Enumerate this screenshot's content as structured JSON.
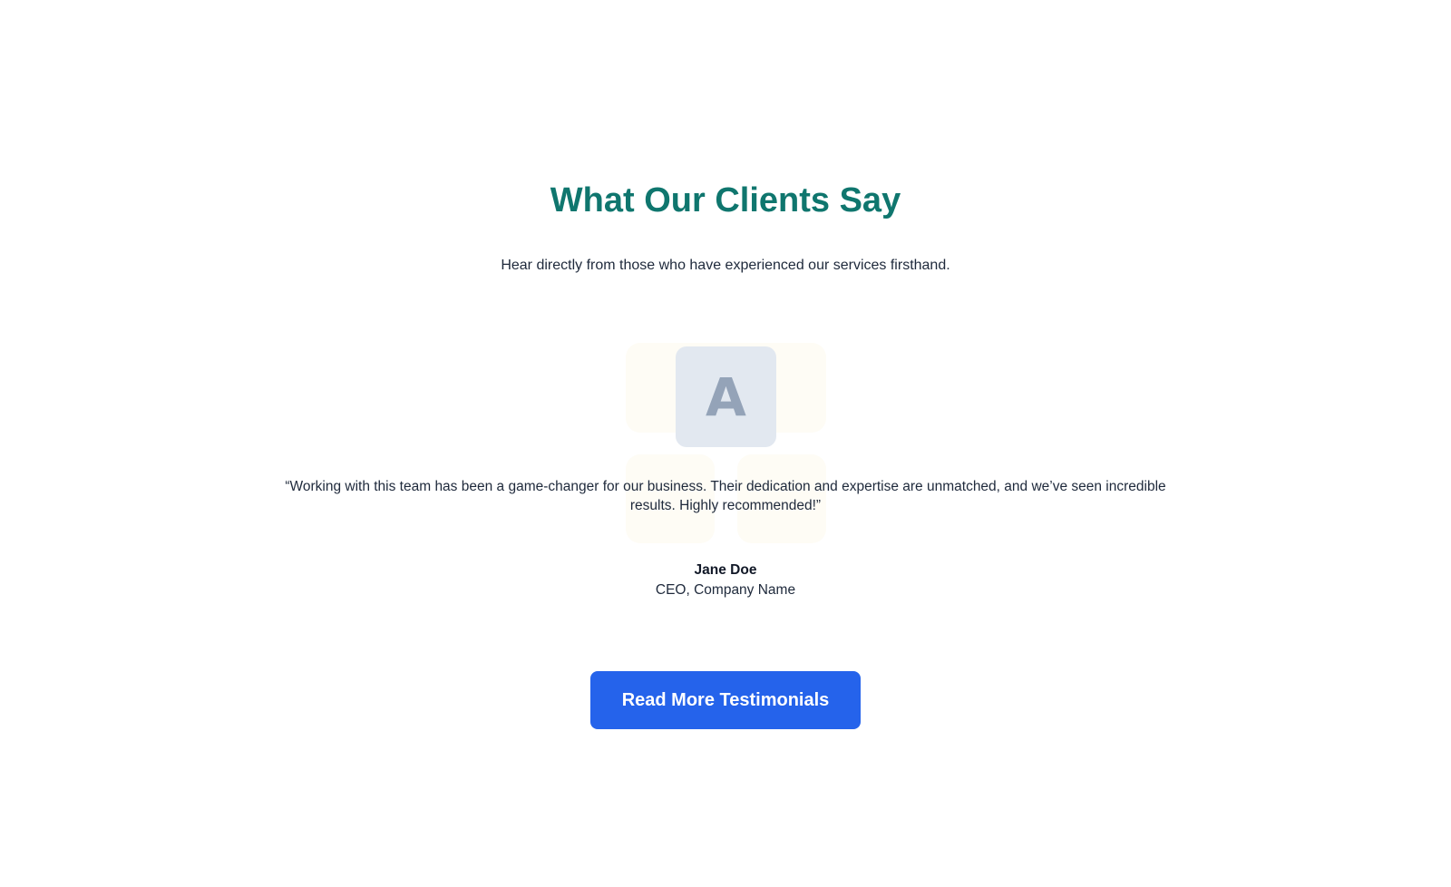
{
  "header": {
    "title": "What Our Clients Say",
    "subtitle": "Hear directly from those who have experienced our services firsthand."
  },
  "testimonial": {
    "avatar_initial": "A",
    "quote": "“Working with this team has been a game-changer for our business. Their dedication and expertise are unmatched, and we’ve seen incredible results. Highly recommended!”",
    "author_name": "Jane Doe",
    "author_role": "CEO, Company Name"
  },
  "cta": {
    "label": "Read More Testimonials"
  },
  "colors": {
    "title": "#0f766e",
    "button": "#2563eb",
    "avatar_bg": "#e2e8f0",
    "avatar_text": "#94a3b8",
    "tile_bg": "#fefcf5"
  }
}
